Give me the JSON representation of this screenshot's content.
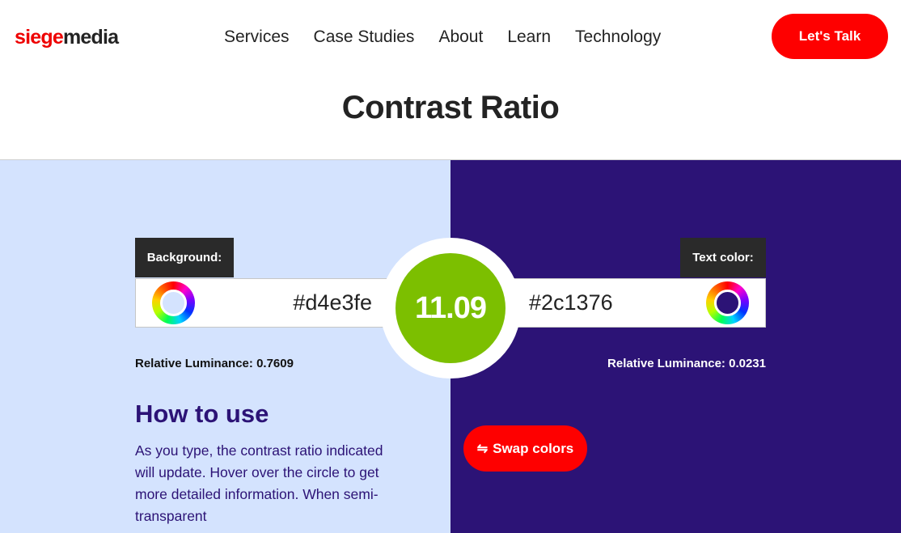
{
  "header": {
    "logo": {
      "part1": "siege",
      "part2": "media"
    },
    "nav": [
      {
        "label": "Services"
      },
      {
        "label": "Case Studies"
      },
      {
        "label": "About"
      },
      {
        "label": "Learn"
      },
      {
        "label": "Technology"
      }
    ],
    "cta_label": "Let's Talk"
  },
  "page_title": "Contrast Ratio",
  "background": {
    "tag_label": "Background:",
    "value": "#d4e3fe",
    "luminance_label": "Relative Luminance:",
    "luminance_value": "0.7609",
    "color": "#d4e3fe"
  },
  "text_color": {
    "tag_label": "Text color:",
    "value": "#2c1376",
    "luminance_label": "Relative Luminance:",
    "luminance_value": "0.0231",
    "color": "#2c1376"
  },
  "ratio": {
    "value": "11.09",
    "color": "#7cbf00"
  },
  "how_to_use": {
    "title": "How to use",
    "text": "As you type, the contrast ratio indicated will update. Hover over the circle to get more detailed information. When semi-transparent"
  },
  "swap_button": {
    "icon": "swap-arrows-icon",
    "glyph": "⇋",
    "label": "Swap colors"
  },
  "colors": {
    "accent_red": "#fe0000",
    "tag_dark": "#2a2a2a"
  }
}
